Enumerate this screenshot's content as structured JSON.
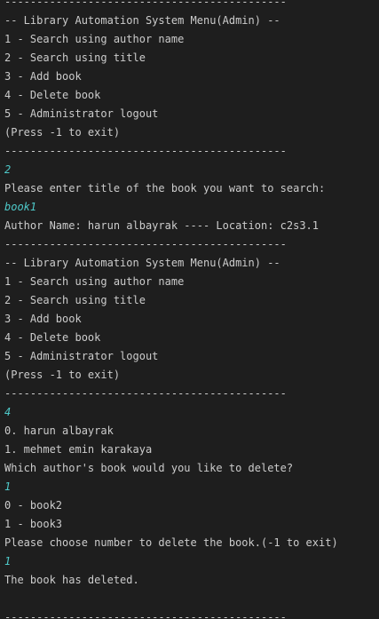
{
  "terminal": {
    "lines": [
      {
        "text": "--------------------------------------------",
        "kind": "output"
      },
      {
        "text": "-- Library Automation System Menu(Admin) --",
        "kind": "output"
      },
      {
        "text": "1 - Search using author name",
        "kind": "output"
      },
      {
        "text": "2 - Search using title",
        "kind": "output"
      },
      {
        "text": "3 - Add book",
        "kind": "output"
      },
      {
        "text": "4 - Delete book",
        "kind": "output"
      },
      {
        "text": "5 - Administrator logout",
        "kind": "output"
      },
      {
        "text": "(Press -1 to exit)",
        "kind": "output"
      },
      {
        "text": "--------------------------------------------",
        "kind": "output"
      },
      {
        "text": "2",
        "kind": "input"
      },
      {
        "text": "Please enter title of the book you want to search:",
        "kind": "output"
      },
      {
        "text": "book1",
        "kind": "input"
      },
      {
        "text": "Author Name: harun albayrak ---- Location: c2s3.1",
        "kind": "output"
      },
      {
        "text": "--------------------------------------------",
        "kind": "output"
      },
      {
        "text": "-- Library Automation System Menu(Admin) --",
        "kind": "output"
      },
      {
        "text": "1 - Search using author name",
        "kind": "output"
      },
      {
        "text": "2 - Search using title",
        "kind": "output"
      },
      {
        "text": "3 - Add book",
        "kind": "output"
      },
      {
        "text": "4 - Delete book",
        "kind": "output"
      },
      {
        "text": "5 - Administrator logout",
        "kind": "output"
      },
      {
        "text": "(Press -1 to exit)",
        "kind": "output"
      },
      {
        "text": "--------------------------------------------",
        "kind": "output"
      },
      {
        "text": "4",
        "kind": "input"
      },
      {
        "text": "0. harun albayrak",
        "kind": "output"
      },
      {
        "text": "1. mehmet emin karakaya",
        "kind": "output"
      },
      {
        "text": "Which author's book would you like to delete?",
        "kind": "output"
      },
      {
        "text": "1",
        "kind": "input"
      },
      {
        "text": "0 - book2",
        "kind": "output"
      },
      {
        "text": "1 - book3",
        "kind": "output"
      },
      {
        "text": "Please choose number to delete the book.(-1 to exit)",
        "kind": "output"
      },
      {
        "text": "1",
        "kind": "input"
      },
      {
        "text": "The book has deleted.",
        "kind": "output"
      },
      {
        "text": "",
        "kind": "output"
      },
      {
        "text": "--------------------------------------------",
        "kind": "output"
      }
    ]
  },
  "colors": {
    "background": "#1e1e1e",
    "output_text": "#cccccc",
    "input_text": "#4ec9c9"
  }
}
